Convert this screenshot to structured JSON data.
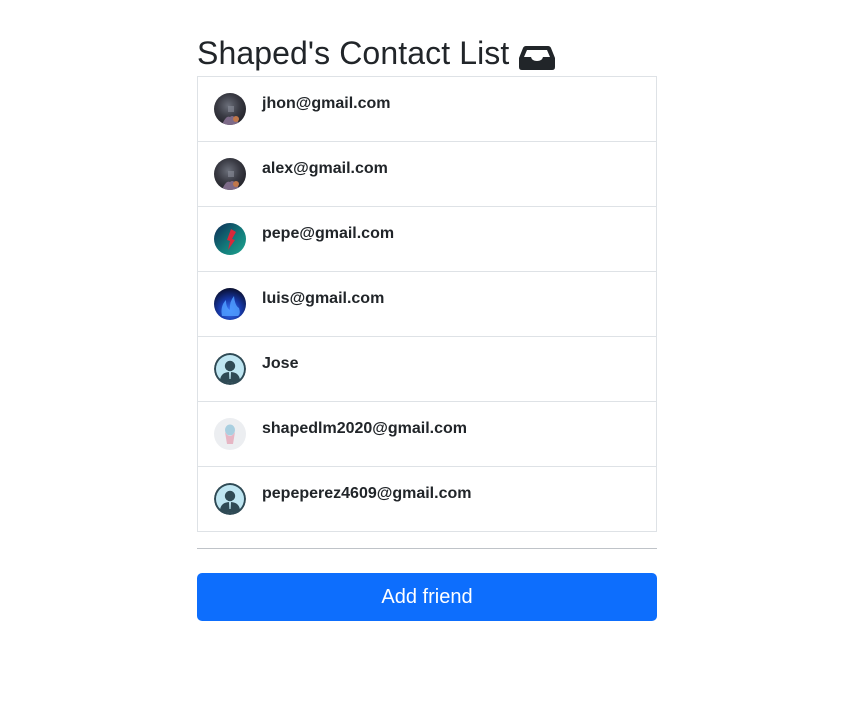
{
  "header": {
    "title": "Shaped's Contact List",
    "icon": "inbox-tray-icon"
  },
  "contacts": [
    {
      "label": "jhon@gmail.com",
      "avatar": "photo-dark"
    },
    {
      "label": "alex@gmail.com",
      "avatar": "photo-dark"
    },
    {
      "label": "pepe@gmail.com",
      "avatar": "photo-teal-red"
    },
    {
      "label": "luis@gmail.com",
      "avatar": "photo-blue-flame"
    },
    {
      "label": "Jose",
      "avatar": "default-user"
    },
    {
      "label": "shapedlm2020@gmail.com",
      "avatar": "photo-light"
    },
    {
      "label": "pepeperez4609@gmail.com",
      "avatar": "default-user"
    }
  ],
  "actions": {
    "add_friend_label": "Add friend"
  },
  "colors": {
    "primary": "#0d6efd",
    "text": "#212529",
    "border": "#dee2e6"
  }
}
